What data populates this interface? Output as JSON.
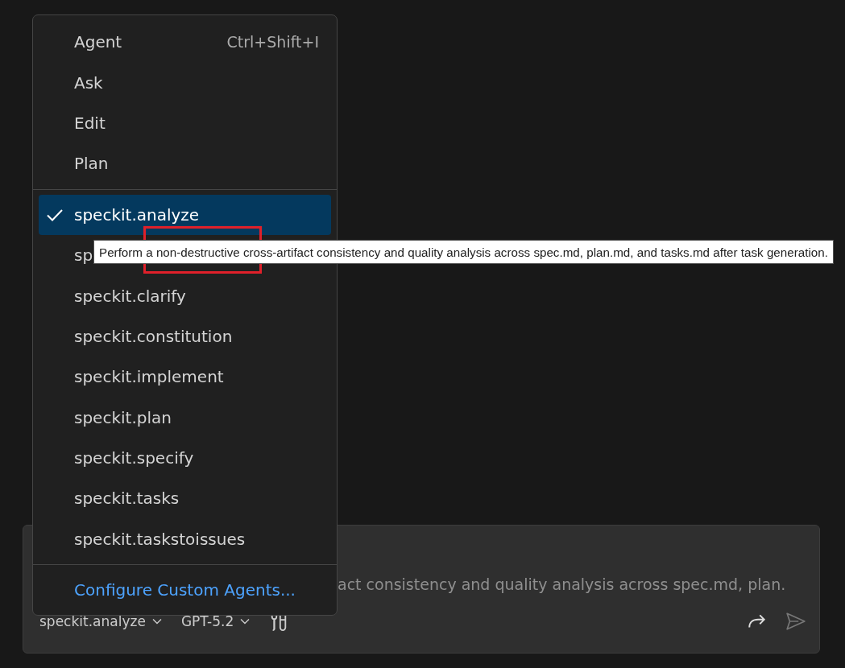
{
  "menu": {
    "groups": [
      {
        "items": [
          {
            "label": "Agent",
            "shortcut": "Ctrl+Shift+I",
            "selected": false
          },
          {
            "label": "Ask",
            "selected": false
          },
          {
            "label": "Edit",
            "selected": false
          },
          {
            "label": "Plan",
            "selected": false
          }
        ]
      },
      {
        "items": [
          {
            "label": "speckit.analyze",
            "selected": true
          },
          {
            "label": "sp",
            "selected": false
          },
          {
            "label": "speckit.clarify",
            "selected": false
          },
          {
            "label": "speckit.constitution",
            "selected": false
          },
          {
            "label": "speckit.implement",
            "selected": false
          },
          {
            "label": "speckit.plan",
            "selected": false
          },
          {
            "label": "speckit.specify",
            "selected": false
          },
          {
            "label": "speckit.tasks",
            "selected": false
          },
          {
            "label": "speckit.taskstoissues",
            "selected": false
          }
        ]
      }
    ],
    "configure_link": "Configure Custom Agents..."
  },
  "tooltip": {
    "text": "Perform a non-destructive cross-artifact consistency and quality analysis across spec.md, plan.md, and tasks.md after task generation."
  },
  "highlight_annotation": true,
  "chat_input": {
    "placeholder": "act consistency and quality analysis across spec.md, plan.",
    "agent_picker": "speckit.analyze",
    "model_picker": "GPT-5.2"
  }
}
